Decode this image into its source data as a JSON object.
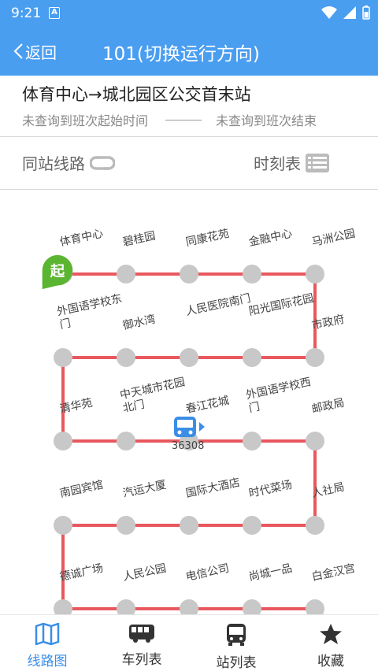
{
  "status": {
    "time": "9:21",
    "app_badge": "A"
  },
  "header": {
    "back_label": "返回",
    "title": "101(切换运行方向)"
  },
  "route": {
    "name": "体育中心→城北园区公交首末站",
    "start_time": "未查询到班次起始时间",
    "end_time": "未查询到班次结束"
  },
  "options": {
    "same_station": "同站线路",
    "timetable": "时刻表"
  },
  "start_badge": "起",
  "stops": [
    "体育中心",
    "碧桂园",
    "同康花苑",
    "金融中心",
    "马洲公园",
    "市政府",
    "阳光国际花园",
    "人民医院南门",
    "御水湾",
    "外国语学校东门",
    "清华苑",
    "中天城市花园北门",
    "春江花城",
    "外国语学校西门",
    "邮政局",
    "人社局",
    "时代菜场",
    "国际大酒店",
    "汽运大厦",
    "南园宾馆",
    "德诚广场",
    "人民公园",
    "电信公司",
    "尚城一品",
    "白金汉宫"
  ],
  "bus": {
    "number": "36308",
    "icon": "bus-icon"
  },
  "nav": {
    "items": [
      {
        "label": "线路图",
        "icon": "map-icon"
      },
      {
        "label": "车列表",
        "icon": "bus-list-icon"
      },
      {
        "label": "站列表",
        "icon": "station-list-icon"
      },
      {
        "label": "收藏",
        "icon": "star-icon"
      }
    ]
  },
  "colors": {
    "primary": "#4a9ef0",
    "route_line": "#e8585e",
    "stop": "#c8c8c8",
    "start": "#5cb531"
  }
}
